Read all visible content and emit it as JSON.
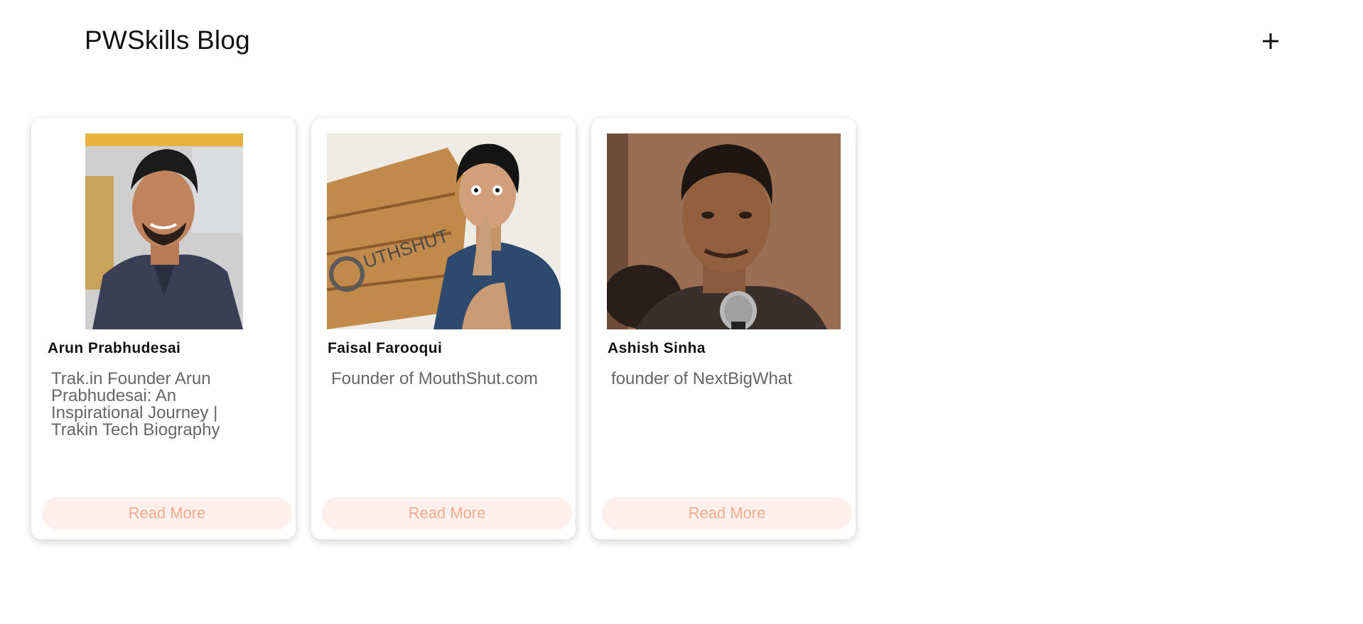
{
  "header": {
    "brand": "PWSkills Blog",
    "add_icon": "plus-icon"
  },
  "cards": [
    {
      "name": "Arun Prabhudesai",
      "description": "Trak.in Founder Arun Prabhudesai: An Inspirational Journey | Trakin Tech Biography",
      "button_label": "Read More"
    },
    {
      "name": "Faisal Farooqui",
      "description": "Founder of MouthShut.com",
      "button_label": "Read More"
    },
    {
      "name": "Ashish Sinha",
      "description": "founder of NextBigWhat",
      "button_label": "Read More"
    }
  ],
  "colors": {
    "button_bg": "#fff0eb",
    "button_text": "#f6ab8f",
    "title_text": "#111111",
    "desc_text": "#666666"
  }
}
